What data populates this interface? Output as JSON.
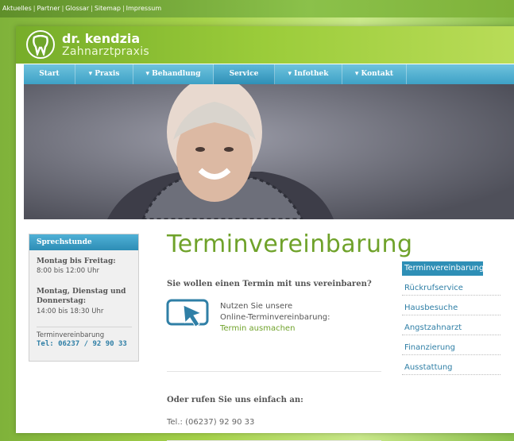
{
  "topbar": {
    "links": [
      "Aktuelles",
      "Partner",
      "Glossar",
      "Sitemap",
      "Impressum"
    ],
    "separator": "|"
  },
  "brand": {
    "name": "dr. kendzia",
    "subtitle": "Zahnarztpraxis"
  },
  "nav": {
    "items": [
      {
        "label": "Start"
      },
      {
        "label": "▾ Praxis"
      },
      {
        "label": "▾ Behandlung"
      },
      {
        "label": "Service"
      },
      {
        "label": "▾ Infothek"
      },
      {
        "label": "▾ Kontakt"
      }
    ]
  },
  "sprechstunde": {
    "title": "Sprechstunde",
    "blocks": [
      {
        "label": "Montag bis Freitag:",
        "hours": "8:00 bis 12:00 Uhr"
      },
      {
        "label": "Montag, Dienstag und Donnerstag:",
        "hours": "14:00 bis 18:30 Uhr"
      }
    ],
    "appointment_label": "Terminvereinbarung",
    "phone": "Tel: 06237 / 92 90 33"
  },
  "main": {
    "title": "Terminvereinbarung",
    "question": "Sie wollen einen Termin mit uns vereinbaren?",
    "online_line1": "Nutzen Sie unsere",
    "online_line2": "Online-Terminvereinbarung:",
    "online_link": "Termin ausmachen",
    "call_heading": "Oder rufen Sie uns einfach an:",
    "tel": "Tel.: (06237) 92 90 33"
  },
  "right_nav": {
    "items": [
      {
        "label": "Terminvereinbarung",
        "active": true
      },
      {
        "label": "Rückrufservice"
      },
      {
        "label": "Hausbesuche"
      },
      {
        "label": "Angstzahnarzt"
      },
      {
        "label": "Finanzierung"
      },
      {
        "label": "Ausstattung"
      }
    ]
  },
  "colors": {
    "green": "#6fa22a",
    "blue": "#2e8fb6",
    "nav_blue": "#3ea1c6"
  }
}
